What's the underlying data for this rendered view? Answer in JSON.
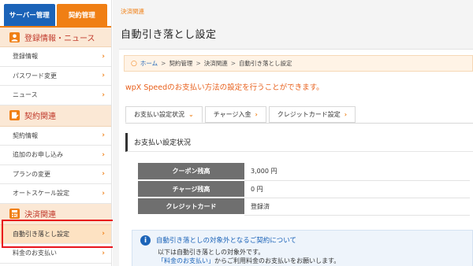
{
  "sidebar": {
    "top_tabs": [
      "サーバー管理",
      "契約管理"
    ],
    "sections": [
      {
        "title": "登録情報・ニュース",
        "icon": "person-icon",
        "items": [
          "登録情報",
          "パスワード変更",
          "ニュース"
        ]
      },
      {
        "title": "契約関連",
        "icon": "contract-icon",
        "items": [
          "契約情報",
          "追加のお申し込み",
          "プランの変更",
          "オートスケール設定"
        ]
      },
      {
        "title": "決済関連",
        "icon": "calculator-icon",
        "items": [
          "自動引き落とし設定",
          "料金のお支払い"
        ]
      }
    ],
    "chevron": "›"
  },
  "header": {
    "category": "決済関連",
    "title": "自動引き落とし設定"
  },
  "breadcrumb": {
    "home": "ホーム",
    "items": [
      "契約管理",
      "決済関連",
      "自動引き落とし設定"
    ],
    "separator": ">"
  },
  "lead": "wpX Speedのお支払い方法の設定を行うことができます。",
  "tabs": [
    {
      "label": "お支払い設定状況",
      "chev": "⌄"
    },
    {
      "label": "チャージ入金",
      "chev": "›"
    },
    {
      "label": "クレジットカード設定",
      "chev": "›"
    }
  ],
  "section_title": "お支払い設定状況",
  "table": [
    {
      "label": "クーポン残高",
      "value": "3,000 円"
    },
    {
      "label": "チャージ残高",
      "value": "0 円"
    },
    {
      "label": "クレジットカード",
      "value": "登録済"
    }
  ],
  "notice": {
    "title": "自動引き落としの対象外となるご契約について",
    "line1": "以下は自動引き落としの対象外です。",
    "line2_link": "「料金のお支払い」",
    "line2_rest": "からご利用料金のお支払いをお願いします。"
  },
  "colors": {
    "accent": "#f07f14",
    "brand_blue": "#1b63b8",
    "highlight": "#e8141c"
  }
}
